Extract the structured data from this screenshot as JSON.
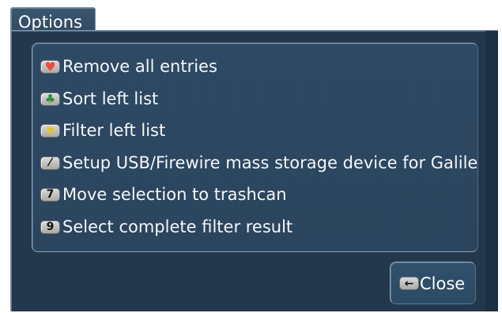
{
  "window": {
    "title": "Options"
  },
  "options": [
    {
      "label": "Remove all entries",
      "key": "♥",
      "icon": "heart-icon"
    },
    {
      "label": "Sort left list",
      "key": "♣",
      "icon": "club-icon"
    },
    {
      "label": "Filter left list",
      "key": "✱",
      "icon": "star-icon"
    },
    {
      "label": "Setup USB/Firewire mass storage device for Galile",
      "key": "⁄",
      "icon": "wrench-icon"
    },
    {
      "label": "Move selection to trashcan",
      "key": "7",
      "icon": "key-7-icon"
    },
    {
      "label": "Select complete filter result",
      "key": "9",
      "icon": "key-9-icon"
    }
  ],
  "close_button": {
    "label": "Close",
    "key": "←",
    "icon": "arrow-left-icon"
  },
  "colors": {
    "dialog_bg": "#24384d",
    "panel_bg": "#2d4863",
    "text": "#f4f8fb"
  }
}
